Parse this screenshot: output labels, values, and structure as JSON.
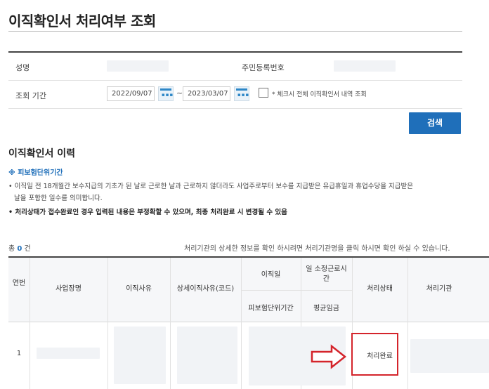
{
  "page": {
    "title": "이직확인서 처리여부 조회"
  },
  "search": {
    "name_label": "성명",
    "rrn_label": "주민등록번호",
    "period_label": "조회 기간",
    "date_from": "2022/09/07",
    "date_separator": "~",
    "date_to": "2023/03/07",
    "all_checkbox_note": "* 체크시 전체 이직확인서 내역 조회",
    "search_button": "검색"
  },
  "history": {
    "title": "이직확인서 이력",
    "note_heading": "※ 피보험단위기간",
    "note_line1": "• 이직일 전 18개월간 보수지급의 기초가 된 날로 근로한 날과 근로하지 않더라도 사업주로부터 보수를 지급받은 유급휴일과 휴업수당을 지급받은",
    "note_line2": "날을 포함한 일수를 의미합니다.",
    "note_line3": "• 처리상태가 접수완료인 경우 입력된 내용은 부정확할 수 있으며, 최종 처리완료 시 변경될 수 있음",
    "total_prefix": "총",
    "total_count": "0",
    "total_unit": "건",
    "guide_text": "처리기관의 상세한 정보를 확인 하시려면 처리기관명을 클릭 하시면 확인 하실 수 있습니다."
  },
  "table": {
    "headers": {
      "seq": "연번",
      "company": "사업장명",
      "reason": "이직사유",
      "reason_detail": "상세이직사유(코드)",
      "leave_date": "이직일",
      "working_hours": "일 소정근로시간",
      "status": "처리상태",
      "agency": "처리기관",
      "insured_period": "피보험단위기간",
      "avg_wage": "평균임금"
    },
    "rows": [
      {
        "seq": "1",
        "status": "처리완료"
      }
    ]
  },
  "colors": {
    "primary": "#1f6fba",
    "highlight": "#d4242b"
  }
}
